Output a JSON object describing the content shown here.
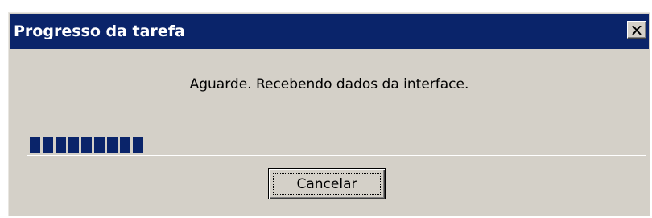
{
  "window": {
    "title": "Progresso da tarefa",
    "close_icon": "close-icon"
  },
  "message": "Aguarde. Recebendo dados da interface.",
  "progress": {
    "filled_blocks": 9,
    "fraction": 0.21,
    "color": "#0a246a"
  },
  "buttons": {
    "cancel_label": "Cancelar"
  },
  "colors": {
    "titlebar": "#0a246a",
    "dialog_face": "#d4d0c8",
    "title_text": "#ffffff"
  }
}
